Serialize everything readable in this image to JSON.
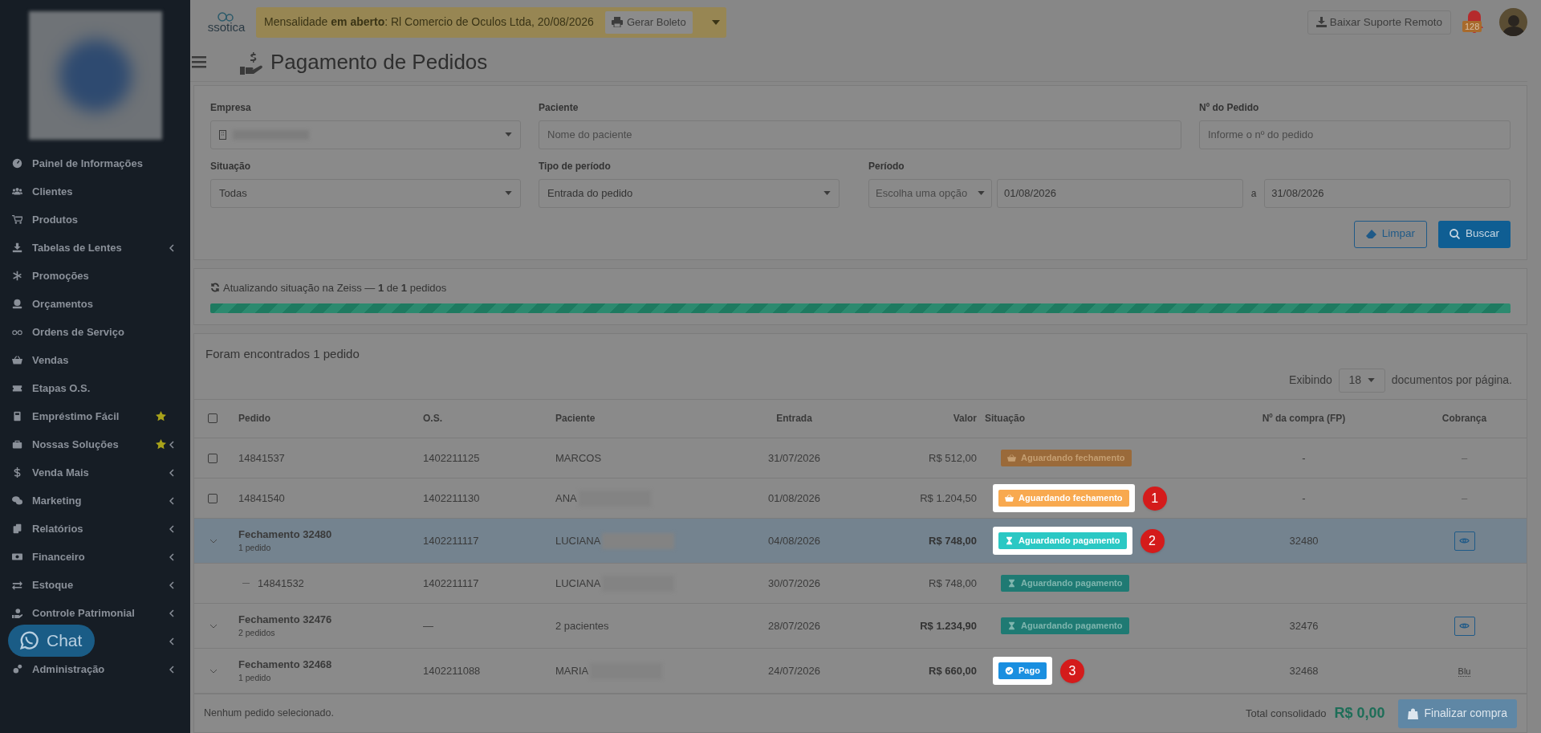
{
  "brand": {
    "text": "ssotica"
  },
  "notice": {
    "text": "Mensalidade **em aberto**: Rl Comercio de Oculos Ltda, 20/08/2026",
    "button": "Gerar Boleto"
  },
  "support_button": "Baixar Suporte Remoto",
  "notifications": {
    "count": "128"
  },
  "page_title": "Pagamento de Pedidos",
  "sidebar": {
    "items": [
      {
        "label": "Painel de Informações",
        "submenu": false,
        "starred": false
      },
      {
        "label": "Clientes",
        "submenu": false,
        "starred": false
      },
      {
        "label": "Produtos",
        "submenu": false,
        "starred": false
      },
      {
        "label": "Tabelas de Lentes",
        "submenu": true,
        "starred": false
      },
      {
        "label": "Promoções",
        "submenu": false,
        "starred": false
      },
      {
        "label": "Orçamentos",
        "submenu": false,
        "starred": false
      },
      {
        "label": "Ordens de Serviço",
        "submenu": false,
        "starred": false
      },
      {
        "label": "Vendas",
        "submenu": false,
        "starred": false
      },
      {
        "label": "Etapas O.S.",
        "submenu": false,
        "starred": false
      },
      {
        "label": "Empréstimo Fácil",
        "submenu": false,
        "starred": true
      },
      {
        "label": "Nossas Soluções",
        "submenu": true,
        "starred": true
      },
      {
        "label": "Venda Mais",
        "submenu": true,
        "starred": false
      },
      {
        "label": "Marketing",
        "submenu": true,
        "starred": false
      },
      {
        "label": "Relatórios",
        "submenu": true,
        "starred": false
      },
      {
        "label": "Financeiro",
        "submenu": true,
        "starred": false
      },
      {
        "label": "Estoque",
        "submenu": true,
        "starred": false
      },
      {
        "label": "Controle Patrimonial",
        "submenu": true,
        "starred": false
      },
      {
        "submenu": true,
        "starred": false
      },
      {
        "label": "Administração",
        "submenu": true,
        "starred": false
      }
    ]
  },
  "chat_button": "Chat",
  "filters": {
    "empresa": {
      "label": "Empresa"
    },
    "paciente": {
      "label": "Paciente",
      "placeholder": "Nome do paciente"
    },
    "pedido": {
      "label": "Nº do Pedido",
      "placeholder": "Informe o nº do pedido"
    },
    "situacao": {
      "label": "Situação",
      "value": "Todas"
    },
    "tipo_periodo": {
      "label": "Tipo de período",
      "value": "Entrada do pedido"
    },
    "periodo": {
      "label": "Período",
      "preset": "Escolha uma opção",
      "start": "01/08/2026",
      "separator": "a",
      "end": "31/08/2026"
    },
    "buttons": [
      {
        "kind": "outline",
        "label": "Limpar"
      },
      {
        "kind": "primary",
        "label": "Buscar"
      }
    ]
  },
  "progress": {
    "text": "Atualizando situação na Zeiss — **1** de **1** pedidos",
    "level": 1
  },
  "results": {
    "title": "Foram encontrados 1 pedido",
    "page_size_before": "Exibindo",
    "page_size": "18",
    "page_size_after": "documentos por página."
  },
  "table": {
    "header_checked": false,
    "columns": [
      "Pedido",
      "O.S.",
      "Paciente",
      "Entrada",
      "Valor",
      "Situação",
      "Nº da compra (FP)",
      "Cobrança"
    ],
    "rows": [
      {
        "kind": "order",
        "selected": false,
        "checked": false,
        "pedido": "14841537",
        "os": "1402211125",
        "paciente": "MARCOS",
        "entrada": "31/07/2026",
        "valor": "R$ 512,00",
        "status": {
          "kind": "closing",
          "label": "Aguardando fechamento",
          "highlighted": false
        },
        "fp": "-",
        "cobranca": {
          "kind": "dash",
          "text": "–"
        }
      },
      {
        "kind": "order",
        "selected": false,
        "checked": false,
        "pedido": "14841540",
        "os": "1402211130",
        "paciente": "ANA",
        "entrada": "01/08/2026",
        "valor": "R$ 1.204,50",
        "status": {
          "kind": "closing",
          "label": "Aguardando fechamento",
          "highlighted": true,
          "callout": "1"
        },
        "fp": "-",
        "cobranca": {
          "kind": "dash",
          "text": "–"
        }
      },
      {
        "kind": "group",
        "selected": true,
        "pedido": "Fechamento 32480",
        "subtitle": "1 pedido",
        "os": "1402211117",
        "paciente": "LUCIANA",
        "entrada": "04/08/2026",
        "valor": "R$ 748,00",
        "status": {
          "kind": "payment",
          "label": "Aguardando pagamento",
          "highlighted": true,
          "callout": "2"
        },
        "fp": "32480",
        "cobranca": {
          "kind": "view"
        }
      },
      {
        "kind": "child",
        "selected": false,
        "pedido": "14841532",
        "os": "1402211117",
        "paciente": "LUCIANA",
        "entrada": "30/07/2026",
        "valor": "R$ 748,00",
        "status": {
          "kind": "payment",
          "label": "Aguardando pagamento",
          "highlighted": false
        }
      },
      {
        "kind": "group",
        "selected": false,
        "pedido": "Fechamento 32476",
        "subtitle": "2 pedidos",
        "os": "—",
        "paciente": "2 pacientes",
        "entrada": "28/07/2026",
        "valor": "R$ 1.234,90",
        "status": {
          "kind": "payment",
          "label": "Aguardando pagamento",
          "highlighted": false
        },
        "fp": "32476",
        "cobranca": {
          "kind": "view"
        }
      },
      {
        "kind": "group",
        "selected": false,
        "pedido": "Fechamento 32468",
        "subtitle": "1 pedido",
        "os": "1402211088",
        "paciente": "MARIA",
        "entrada": "24/07/2026",
        "valor": "R$ 660,00",
        "status": {
          "kind": "paid",
          "label": "Pago",
          "highlighted": true,
          "callout": "3"
        },
        "fp": "32468",
        "cobranca": {
          "kind": "text",
          "text": "Blu"
        }
      }
    ]
  },
  "footer": {
    "selection": "Nenhum pedido selecionado.",
    "total_label": "Total consolidado",
    "total": "R$ 0,00",
    "button": "Finalizar compra",
    "disabled": true
  }
}
